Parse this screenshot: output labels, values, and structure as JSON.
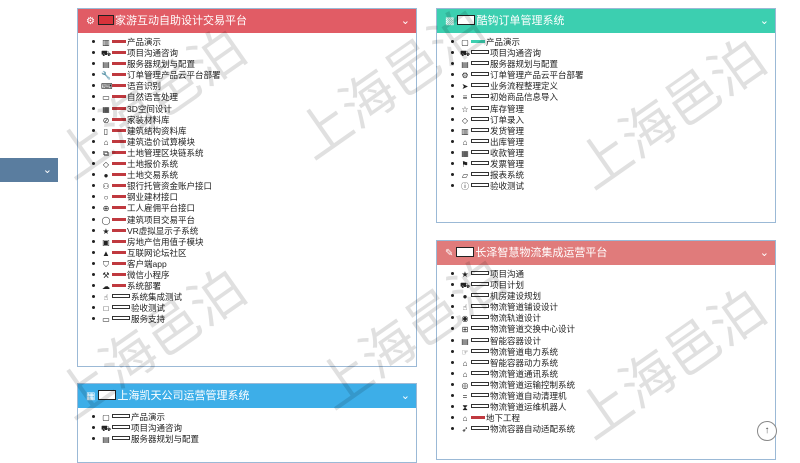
{
  "colors": {
    "red_header": "#e15c65",
    "teal_header": "#3ccfb0",
    "blue_header": "#3daee8",
    "salmon_header": "#e07b7b",
    "sidebar": "#5a7d9f"
  },
  "panel1": {
    "title": "家游互动自助设计交易平台",
    "items": [
      {
        "icon": "bar-chart-icon",
        "text": "产品演示",
        "bar": "red"
      },
      {
        "icon": "car-icon",
        "text": "项目沟通咨询",
        "bar": "red"
      },
      {
        "icon": "server-icon",
        "text": "服务器规划与配置",
        "bar": "red"
      },
      {
        "icon": "wrench-icon",
        "text": "订单管理产品云平台部署",
        "bar": "red"
      },
      {
        "icon": "keyboard-icon",
        "text": "语音识别",
        "bar": "red"
      },
      {
        "icon": "laptop-icon",
        "text": "自然语言处理",
        "bar": "red"
      },
      {
        "icon": "book-icon",
        "text": "3D空间设计",
        "bar": "red"
      },
      {
        "icon": "ban-icon",
        "text": "家装材料库",
        "bar": "red"
      },
      {
        "icon": "building-icon",
        "text": "建筑结构资料库",
        "bar": "red"
      },
      {
        "icon": "bank-icon",
        "text": "建筑造价试算模块",
        "bar": "red"
      },
      {
        "icon": "sitemap-icon",
        "text": "土地管理区块链系统",
        "bar": "red"
      },
      {
        "icon": "tag-icon",
        "text": "土地报价系统",
        "bar": "red"
      },
      {
        "icon": "user-icon",
        "text": "土地交易系统",
        "bar": "red"
      },
      {
        "icon": "users-icon",
        "text": "银行托管资金账户接口",
        "bar": "red"
      },
      {
        "icon": "user-outline-icon",
        "text": "钢业建材接口",
        "bar": "red"
      },
      {
        "icon": "user-plus-icon",
        "text": "工人雇佣平台接口",
        "bar": "red"
      },
      {
        "icon": "comment-icon",
        "text": "建筑项目交易平台",
        "bar": "red"
      },
      {
        "icon": "star-half-icon",
        "text": "VR虚拟显示子系统",
        "bar": "red"
      },
      {
        "icon": "gift-icon",
        "text": "房地产信用值子模块",
        "bar": "red"
      },
      {
        "icon": "graduation-cap-icon",
        "text": "互联网论坛社区",
        "bar": "red"
      },
      {
        "icon": "shopping-cart-icon",
        "text": "客户端app",
        "bar": "red"
      },
      {
        "icon": "gavel-icon",
        "text": "微信小程序",
        "bar": "red"
      },
      {
        "icon": "cloud-icon",
        "text": "系统部署",
        "bar": "red"
      },
      {
        "icon": "hand-icon",
        "text": "系统集成测试",
        "bar": "outline"
      },
      {
        "icon": "box-icon",
        "text": "验收测试",
        "bar": "outline"
      },
      {
        "icon": "credit-card-icon",
        "text": "服务支持",
        "bar": "outline"
      }
    ]
  },
  "panel2": {
    "title": "上海凯天公司运营管理系统",
    "items": [
      {
        "icon": "desktop-icon",
        "text": "产品演示",
        "bar": "outline"
      },
      {
        "icon": "car-icon",
        "text": "项目沟通咨询",
        "bar": "outline"
      },
      {
        "icon": "server-icon",
        "text": "服务器规划与配置",
        "bar": "outline"
      }
    ]
  },
  "panel3": {
    "title": "酷钩订单管理系统",
    "items": [
      {
        "icon": "desktop-icon",
        "text": "产品演示",
        "bar": "teal"
      },
      {
        "icon": "car-icon",
        "text": "项目沟通咨询",
        "bar": "outline"
      },
      {
        "icon": "server-icon",
        "text": "服务器规划与配置",
        "bar": "outline"
      },
      {
        "icon": "settings-icon",
        "text": "订单管理产品云平台部署",
        "bar": "outline"
      },
      {
        "icon": "send-icon",
        "text": "业务流程整理定义",
        "bar": "outline"
      },
      {
        "icon": "list-icon",
        "text": "初始商品信息导入",
        "bar": "outline"
      },
      {
        "icon": "star-outline-icon",
        "text": "库存管理",
        "bar": "outline"
      },
      {
        "icon": "tag-icon",
        "text": "订单录入",
        "bar": "outline"
      },
      {
        "icon": "bar-chart-icon",
        "text": "发货管理",
        "bar": "outline"
      },
      {
        "icon": "bank-icon",
        "text": "出库管理",
        "bar": "outline"
      },
      {
        "icon": "calendar-icon",
        "text": "收款管理",
        "bar": "outline"
      },
      {
        "icon": "flag-icon",
        "text": "发票管理",
        "bar": "outline"
      },
      {
        "icon": "folder-icon",
        "text": "报表系统",
        "bar": "outline"
      },
      {
        "icon": "info-icon",
        "text": "验收测试",
        "bar": "outline"
      }
    ]
  },
  "panel4": {
    "title": "长泽智慧物流集成运营平台",
    "items": [
      {
        "icon": "star-half-icon",
        "text": "项目沟通",
        "bar": "outline"
      },
      {
        "icon": "car-icon",
        "text": "项目计划",
        "bar": "outline"
      },
      {
        "icon": "user-icon",
        "text": "机房建设规划",
        "bar": "outline"
      },
      {
        "icon": "hand-icon",
        "text": "物流管道铺设设计",
        "bar": "outline"
      },
      {
        "icon": "map-marker-icon",
        "text": "物流轨道设计",
        "bar": "outline"
      },
      {
        "icon": "plus-square-icon",
        "text": "物流管道交换中心设计",
        "bar": "outline"
      },
      {
        "icon": "server-icon",
        "text": "智能容器设计",
        "bar": "outline"
      },
      {
        "icon": "hand-outline-icon",
        "text": "物流管道电力系统",
        "bar": "outline"
      },
      {
        "icon": "bank-icon",
        "text": "智能容器动力系统",
        "bar": "outline"
      },
      {
        "icon": "bank-icon",
        "text": "物流管道通讯系统",
        "bar": "outline"
      },
      {
        "icon": "eye-icon",
        "text": "物流管道运输控制系统",
        "bar": "outline"
      },
      {
        "icon": "equals-icon",
        "text": "物流管道自动清理机",
        "bar": "outline"
      },
      {
        "icon": "hourglass-icon",
        "text": "物流管道运维机器人",
        "bar": "outline"
      },
      {
        "icon": "bank-icon",
        "text": "地下工程",
        "bar": "red"
      },
      {
        "icon": "rocket-icon",
        "text": "物流容器自动适配系统",
        "bar": "outline"
      }
    ]
  },
  "watermark_text": "上海邑泊"
}
